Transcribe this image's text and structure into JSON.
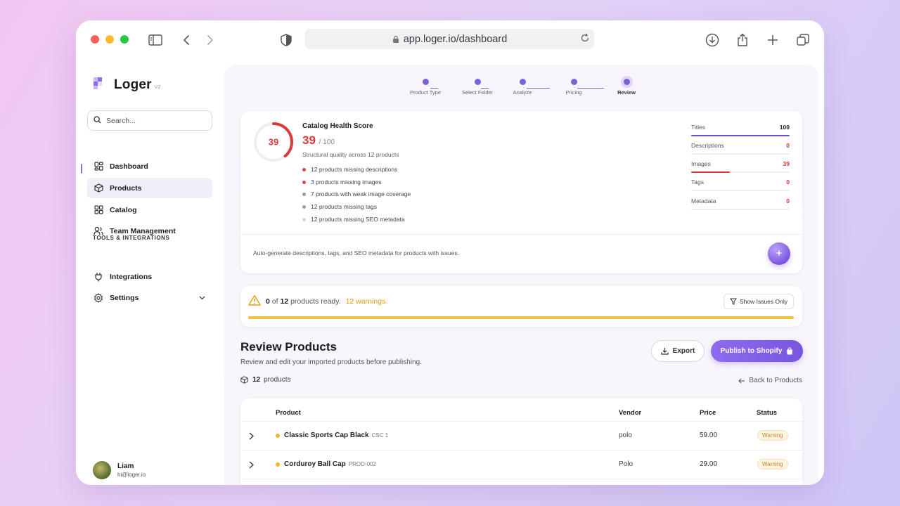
{
  "browser": {
    "url": "app.loger.io/dashboard",
    "traffic_lights": [
      "#ff5f57",
      "#febc2e",
      "#28c840"
    ]
  },
  "brand": {
    "name": "Loger",
    "version": "V2"
  },
  "sidebar": {
    "search_placeholder": "Search...",
    "items": [
      {
        "label": "Dashboard",
        "icon": "grid-icon"
      },
      {
        "label": "Products",
        "icon": "box-icon",
        "active": true
      },
      {
        "label": "Catalog",
        "icon": "grid-icon"
      },
      {
        "label": "Team Management",
        "icon": "users-icon"
      }
    ],
    "section_label": "TOOLS & INTEGRATIONS",
    "tools": [
      {
        "label": "Integrations",
        "icon": "plug-icon"
      },
      {
        "label": "Settings",
        "icon": "gear-icon"
      }
    ],
    "user": {
      "name": "Liam",
      "email": "hi@loger.io"
    }
  },
  "stepper": {
    "steps": [
      "Product Type",
      "Select Folder",
      "Analyze",
      "Pricing",
      "Review"
    ],
    "current": "Review"
  },
  "health": {
    "title": "Catalog Health Score",
    "score": "39",
    "max": "/ 100",
    "score_fraction": 0.39,
    "subtitle": "Structural quality across 12 products",
    "issues": [
      {
        "text": "12 products missing descriptions",
        "color": "#e04646"
      },
      {
        "text": "3 products missing images",
        "color": "#e04646"
      },
      {
        "text": "7 products with weak image coverage",
        "color": "#9a9aa4"
      },
      {
        "text": "12 products missing tags",
        "color": "#9a9aa4"
      },
      {
        "text": "12 products missing SEO metadata",
        "color": "#d4d4da"
      }
    ],
    "metrics": [
      {
        "label": "Titles",
        "value": "100",
        "fraction": 1.0,
        "color": "#6a4fd6"
      },
      {
        "label": "Descriptions",
        "value": "0",
        "fraction": 0,
        "color": "#d93a3a"
      },
      {
        "label": "Images",
        "value": "39",
        "fraction": 0.39,
        "color": "#d93a3a"
      },
      {
        "label": "Tags",
        "value": "0",
        "fraction": 0,
        "color": "#d93a3a"
      },
      {
        "label": "Metadata",
        "value": "0",
        "fraction": 0,
        "color": "#d93a3a"
      }
    ],
    "footer_text": "Auto-generate descriptions, tags, and SEO metadata for products with issues."
  },
  "ready": {
    "ready_count": "0",
    "of_word": "of",
    "total": "12",
    "ready_suffix": "products ready.",
    "warnings": "12 warnings.",
    "filter_label": "Show Issues Only",
    "progress_fraction": 1.0,
    "progress_color": "#f0c23d"
  },
  "review": {
    "title": "Review Products",
    "subtitle": "Review and edit your imported products before publishing.",
    "export_label": "Export",
    "publish_label": "Publish to Shopify",
    "count": "12",
    "count_suffix": "products",
    "back_label": "Back to Products"
  },
  "table": {
    "headers": {
      "product": "Product",
      "vendor": "Vendor",
      "price": "Price",
      "status": "Status"
    },
    "rows": [
      {
        "name": "Classic Sports Cap Black",
        "sku": "CSC 1",
        "vendor": "polo",
        "price": "59.00",
        "status": "Warning"
      },
      {
        "name": "Corduroy Ball Cap",
        "sku": "PROD-002",
        "vendor": "Polo",
        "price": "29.00",
        "status": "Warning"
      }
    ]
  },
  "colors": {
    "accent": "#7a63d4",
    "danger": "#d93a3a",
    "warning": "#f0b82e"
  }
}
